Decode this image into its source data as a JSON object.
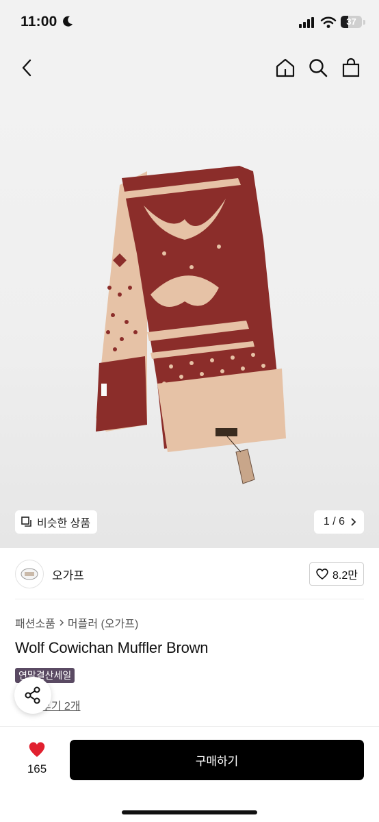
{
  "status_bar": {
    "time": "11:00",
    "battery": "37",
    "battery_level": 0.37
  },
  "nav": {
    "back_icon": "chevron-left-icon",
    "home_icon": "home-icon",
    "search_icon": "search-icon",
    "bag_icon": "shopping-bag-icon"
  },
  "gallery": {
    "similar_label": "비슷한 상품",
    "counter": "1 / 6",
    "image_subject": "knit-scarf-product-photo",
    "colors": {
      "burgundy": "#8b2d2a",
      "beige": "#e6c2a6"
    }
  },
  "seller": {
    "name": "오가프",
    "likes": "8.2만"
  },
  "product": {
    "breadcrumb": [
      "패션소품",
      "머플러 (오가프)"
    ],
    "title": "Wolf Cowichan Muffler Brown",
    "sale_badge": "연말결산세일",
    "reviews_link": "후기 2개"
  },
  "bottom": {
    "wish_count": "165",
    "buy_label": "구매하기"
  },
  "colors": {
    "accent_heart": "#e1202f",
    "badge_bg": "#5a4a63",
    "buy_bg": "#000000"
  }
}
